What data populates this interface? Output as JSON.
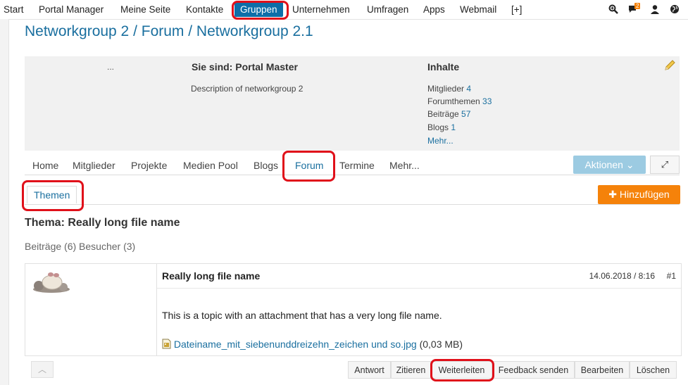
{
  "topnav": {
    "items": [
      "Start",
      "Portal Manager",
      "Meine Seite",
      "Kontakte",
      "Gruppen",
      "Unternehmen",
      "Umfragen",
      "Apps",
      "Webmail",
      "[+]"
    ],
    "active": "Gruppen",
    "notification_count": "2"
  },
  "page": {
    "title": "Networkgroup 2 / Forum / Networkgroup 2.1"
  },
  "info": {
    "avatar_placeholder": "...",
    "you_are": "Sie sind: Portal Master",
    "description": "Description of networkgroup 2",
    "contents_heading": "Inhalte",
    "stats": [
      {
        "label": "Mitglieder",
        "value": "4"
      },
      {
        "label": "Forumthemen",
        "value": "33"
      },
      {
        "label": "Beiträge",
        "value": "57"
      },
      {
        "label": "Blogs",
        "value": "1"
      }
    ],
    "more": "Mehr..."
  },
  "tabs": {
    "items": [
      "Home",
      "Mitglieder",
      "Projekte",
      "Medien Pool",
      "Blogs",
      "Forum",
      "Termine",
      "Mehr..."
    ],
    "active": "Forum",
    "actions_label": "Aktionen",
    "expand_label": "⤢"
  },
  "subtabs": {
    "themen": "Themen",
    "add": "Hinzufügen"
  },
  "topic": {
    "heading": "Thema: Really long file name",
    "counts": "Beiträge (6) Besucher (3)"
  },
  "post": {
    "title": "Really long file name",
    "date": "14.06.2018 / 8:16",
    "number": "#1",
    "body": "This is a topic with an attachment that has a very long file name.",
    "attachment_name": "Dateiname_mit_siebenunddreizehn_zeichen und so.jpg",
    "attachment_size": "(0,03 MB)"
  },
  "post_actions": [
    "Antwort",
    "Zitieren",
    "Weiterleiten",
    "Feedback senden",
    "Bearbeiten",
    "Löschen"
  ],
  "colors": {
    "accent": "#1a6f9f",
    "active_nav": "#0d6ea8",
    "highlight": "#e0101a",
    "add_button": "#f5820a",
    "actions_button": "#9ccbe2"
  }
}
